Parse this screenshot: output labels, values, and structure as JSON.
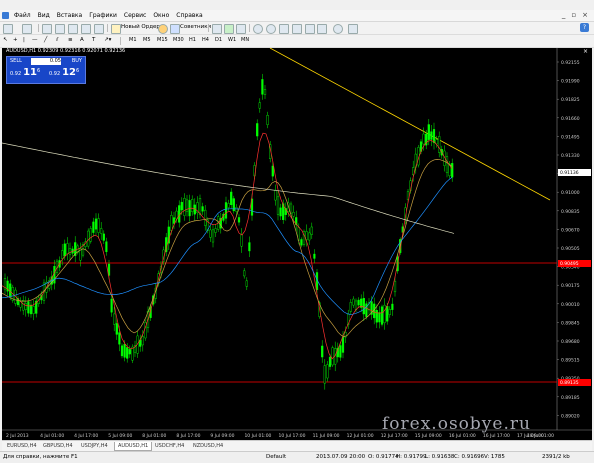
{
  "menu": {
    "items": [
      "Файл",
      "Вид",
      "Вставка",
      "Графики",
      "Сервис",
      "Окно",
      "Справка"
    ]
  },
  "toolbar": {
    "new_order": "Новый Ордер",
    "advisors": "Советники",
    "timeframes": [
      "M1",
      "M5",
      "M15",
      "M30",
      "H1",
      "H4",
      "D1",
      "W1",
      "MN"
    ]
  },
  "chart": {
    "title": "AUDUSD,H1  0.92309 0.92316 0.92071 0.92136",
    "price_labels": [
      "0.92155",
      "0.91990",
      "0.91825",
      "0.91660",
      "0.91495",
      "0.91330",
      "0.91165",
      "0.91000",
      "0.90835",
      "0.90670",
      "0.90505",
      "0.90340",
      "0.90175",
      "0.90010",
      "0.89845",
      "0.89680",
      "0.89515",
      "0.89350",
      "0.89185",
      "0.89020"
    ],
    "current_price": "0.91136",
    "red_level_1": "0.90495",
    "red_level_2": "0.89135",
    "time_labels": [
      "2 Jul 2013",
      "4 Jul 01:00",
      "4 Jul 17:00",
      "5 Jul 09:00",
      "8 Jul 01:00",
      "8 Jul 17:00",
      "9 Jul 09:00",
      "10 Jul 01:00",
      "10 Jul 17:00",
      "11 Jul 09:00",
      "12 Jul 01:00",
      "12 Jul 17:00",
      "15 Jul 09:00",
      "16 Jul 01:00",
      "16 Jul 17:00",
      "17 Jul 09:00",
      "18 Jul 01:00"
    ],
    "colors": {
      "candle": "#00ff00",
      "ma_fast": "#ff3030",
      "ma_mid": "#c8a040",
      "ma_slow": "#1e90ff",
      "ma_long": "#e0e0c0",
      "trendline": "#ffd700",
      "level": "#ff0000"
    }
  },
  "oneclick": {
    "sell_label": "SELL",
    "buy_label": "BUY",
    "lot": "0.05",
    "sell_small": "0.92",
    "sell_big": "11",
    "sell_sup": "6",
    "buy_small": "0.92",
    "buy_big": "12",
    "buy_sup": "6"
  },
  "tabs": [
    "EURUSD,H4",
    "GBPUSD,H4",
    "USDJPY,H4",
    "AUDUSD,H1",
    "USDCHF,H4",
    "NZDUSD,H4"
  ],
  "active_tab": 3,
  "status": {
    "help": "Для справки, нажмите F1",
    "profile": "Default",
    "datetime": "2013.07.09 20:00",
    "open": "O: 0.91774",
    "high": "H: 0.91799",
    "low": "L: 0.91638",
    "close": "C: 0.91696",
    "volume": "V: 1785",
    "traffic": "2391/2 kb"
  },
  "watermark": "forex.osobye.ru"
}
